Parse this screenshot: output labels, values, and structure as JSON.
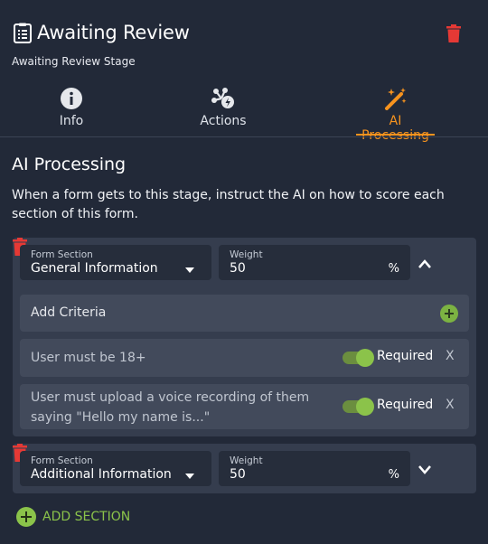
{
  "header": {
    "title": "Awaiting Review",
    "subtitle": "Awaiting Review Stage",
    "icon": "clipboard-list-icon",
    "delete_icon": "trash-icon",
    "delete_color": "#e53935"
  },
  "tabs": [
    {
      "label": "Info",
      "icon": "info-circle-icon",
      "active": false
    },
    {
      "label": "Actions",
      "icon": "actions-gear-icon",
      "active": false
    },
    {
      "label": "AI Processing",
      "icon": "magic-wand-icon",
      "active": true
    }
  ],
  "accent_color": "#f7931e",
  "ai": {
    "heading": "AI Processing",
    "description": "When a form gets to this stage, instruct the AI on how to score each section of this form."
  },
  "sections": [
    {
      "section_label": "Form Section",
      "section_value": "General Information",
      "weight_label": "Weight",
      "weight_value": "50",
      "weight_unit": "%",
      "expanded": true,
      "add_criteria_label": "Add Criteria",
      "criteria": [
        {
          "text": "User must be 18+",
          "required": true,
          "required_label": "Required",
          "remove_label": "X"
        },
        {
          "text": "User must upload a voice recording of them saying \"Hello my name is...\"",
          "required": true,
          "required_label": "Required",
          "remove_label": "X"
        }
      ]
    },
    {
      "section_label": "Form Section",
      "section_value": "Additional Information",
      "weight_label": "Weight",
      "weight_value": "50",
      "weight_unit": "%",
      "expanded": false
    }
  ],
  "add_section_label": "ADD SECTION",
  "success_color": "#8bc34a"
}
